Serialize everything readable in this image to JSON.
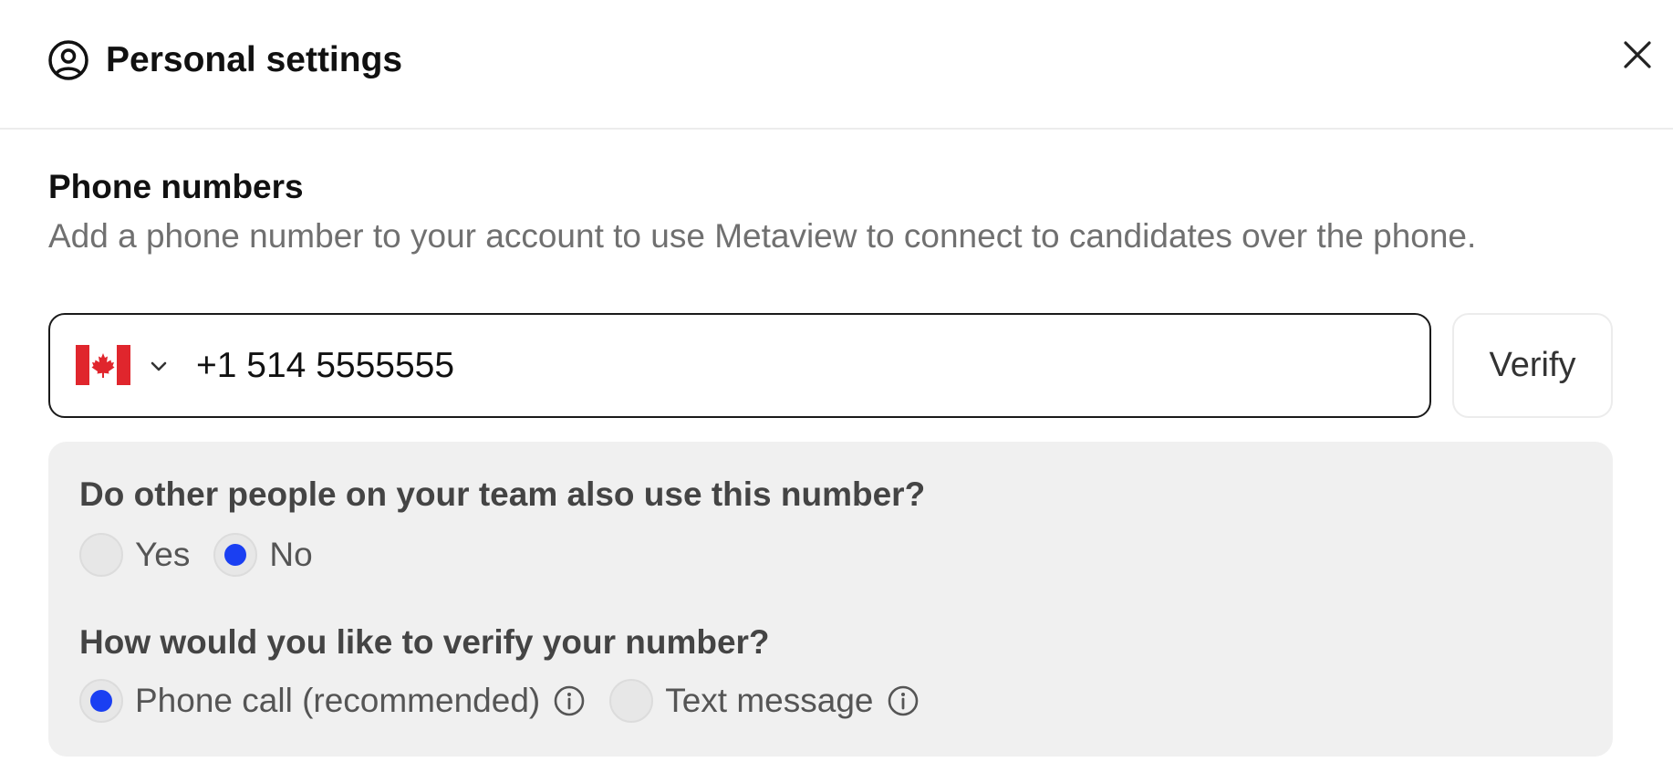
{
  "header": {
    "title": "Personal settings",
    "icon": "user-circle-icon",
    "close_icon": "close-icon"
  },
  "phone_section": {
    "title": "Phone numbers",
    "description": "Add a phone number to your account to use Metaview to connect to candidates over the phone.",
    "country_flag": "canada-flag-icon",
    "phone_value": "+1 514 5555555",
    "verify_label": "Verify"
  },
  "options": {
    "shared_question": "Do other people on your team also use this number?",
    "shared_options": [
      {
        "label": "Yes",
        "checked": false
      },
      {
        "label": "No",
        "checked": true
      }
    ],
    "verify_question": "How would you like to verify your number?",
    "verify_options": [
      {
        "label": "Phone call (recommended)",
        "checked": true,
        "info": "info-icon"
      },
      {
        "label": "Text message",
        "checked": false,
        "info": "info-icon"
      }
    ]
  },
  "colors": {
    "accent": "#1a3ff2",
    "panel_bg": "#f0f0f0",
    "muted_text": "#707070"
  }
}
